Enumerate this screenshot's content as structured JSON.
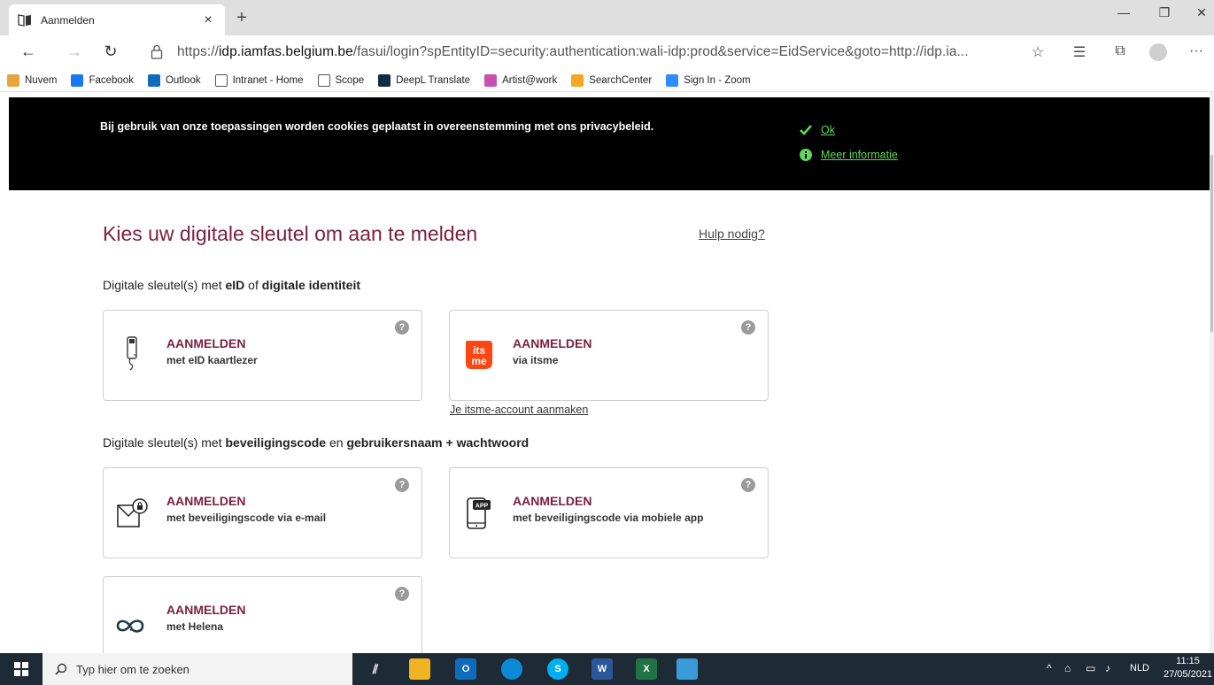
{
  "browser": {
    "tab_title": "Aanmelden",
    "tab_close": "×",
    "new_tab": "+",
    "window_controls": {
      "minimize": "—",
      "maximize": "❐",
      "close": "✕"
    },
    "url_prefix": "https://",
    "url_host": "idp.iamfas.belgium.be",
    "url_path": "/fasui/login?spEntityID=security:authentication:wali-idp:prod&service=EidService&goto=http://idp.ia...",
    "more_menu": "···"
  },
  "bookmarks": [
    {
      "label": "Nuvem",
      "color": "#e8a33d"
    },
    {
      "label": "Facebook",
      "color": "#1877f2"
    },
    {
      "label": "Outlook",
      "color": "#0f6cbd"
    },
    {
      "label": "Intranet - Home",
      "color": "#ffffff"
    },
    {
      "label": "Scope",
      "color": "#ffffff"
    },
    {
      "label": "DeepL Translate",
      "color": "#0f2b46"
    },
    {
      "label": "Artist@work",
      "color": "#c94fb0"
    },
    {
      "label": "SearchCenter",
      "color": "#f5a623"
    },
    {
      "label": "Sign In - Zoom",
      "color": "#2d8cff"
    }
  ],
  "cookie_banner": {
    "text": "Bij gebruik van onze toepassingen worden cookies geplaatst in overeenstemming met ons privacybeleid.",
    "ok": "Ok",
    "more_info": "Meer informatie"
  },
  "main": {
    "title": "Kies uw digitale sleutel om aan te melden",
    "help": "Hulp nodig?",
    "section1": {
      "prefix": "Digitale sleutel(s) met ",
      "b1": "eID",
      "mid": " of ",
      "b2": "digitale identiteit"
    },
    "section2": {
      "prefix": "Digitale sleutel(s) met ",
      "b1": "beveiligingscode",
      "mid": " en ",
      "b2": "gebruikersnaam + wachtwoord"
    },
    "itsme_link": "Je itsme-account aanmaken",
    "cards": [
      {
        "title": "AANMELDEN",
        "sub": "met eID kaartlezer",
        "icon": "card-reader-icon"
      },
      {
        "title": "AANMELDEN",
        "sub": "via itsme",
        "icon": "itsme-logo-icon"
      },
      {
        "title": "AANMELDEN",
        "sub": "met beveiligingscode via e-mail",
        "icon": "email-lock-icon"
      },
      {
        "title": "AANMELDEN",
        "sub": "met beveiligingscode via mobiele app",
        "icon": "mobile-app-icon"
      },
      {
        "title": "AANMELDEN",
        "sub": "met Helena",
        "icon": "helena-icon"
      }
    ],
    "help_badge": "?",
    "accent_color": "#7b2040"
  },
  "taskbar": {
    "search_placeholder": "Typ hier om te zoeken",
    "language": "NLD",
    "time": "11:15",
    "date": "27/05/2021"
  }
}
